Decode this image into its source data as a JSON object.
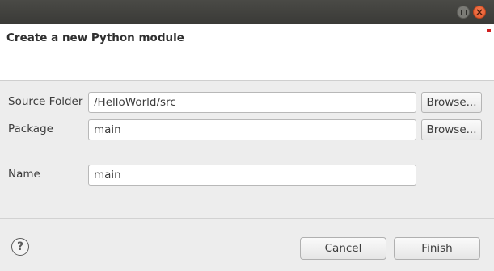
{
  "dialog": {
    "title": "Create a new Python module"
  },
  "form": {
    "source_folder": {
      "label": "Source Folder",
      "value": "/HelloWorld/src",
      "browse_label": "Browse..."
    },
    "package": {
      "label": "Package",
      "value": "main",
      "browse_label": "Browse..."
    },
    "name": {
      "label": "Name",
      "value": "main"
    }
  },
  "footer": {
    "help_glyph": "?",
    "cancel_label": "Cancel",
    "finish_label": "Finish"
  },
  "window_controls": {
    "close_glyph": "×"
  },
  "colors": {
    "titlebar": "#3a3a37",
    "close_button": "#e2572c",
    "banner_background": "#ffffff",
    "dialog_background": "#ededed"
  },
  "icons": [
    "maximize-icon",
    "close-icon",
    "help-icon"
  ]
}
